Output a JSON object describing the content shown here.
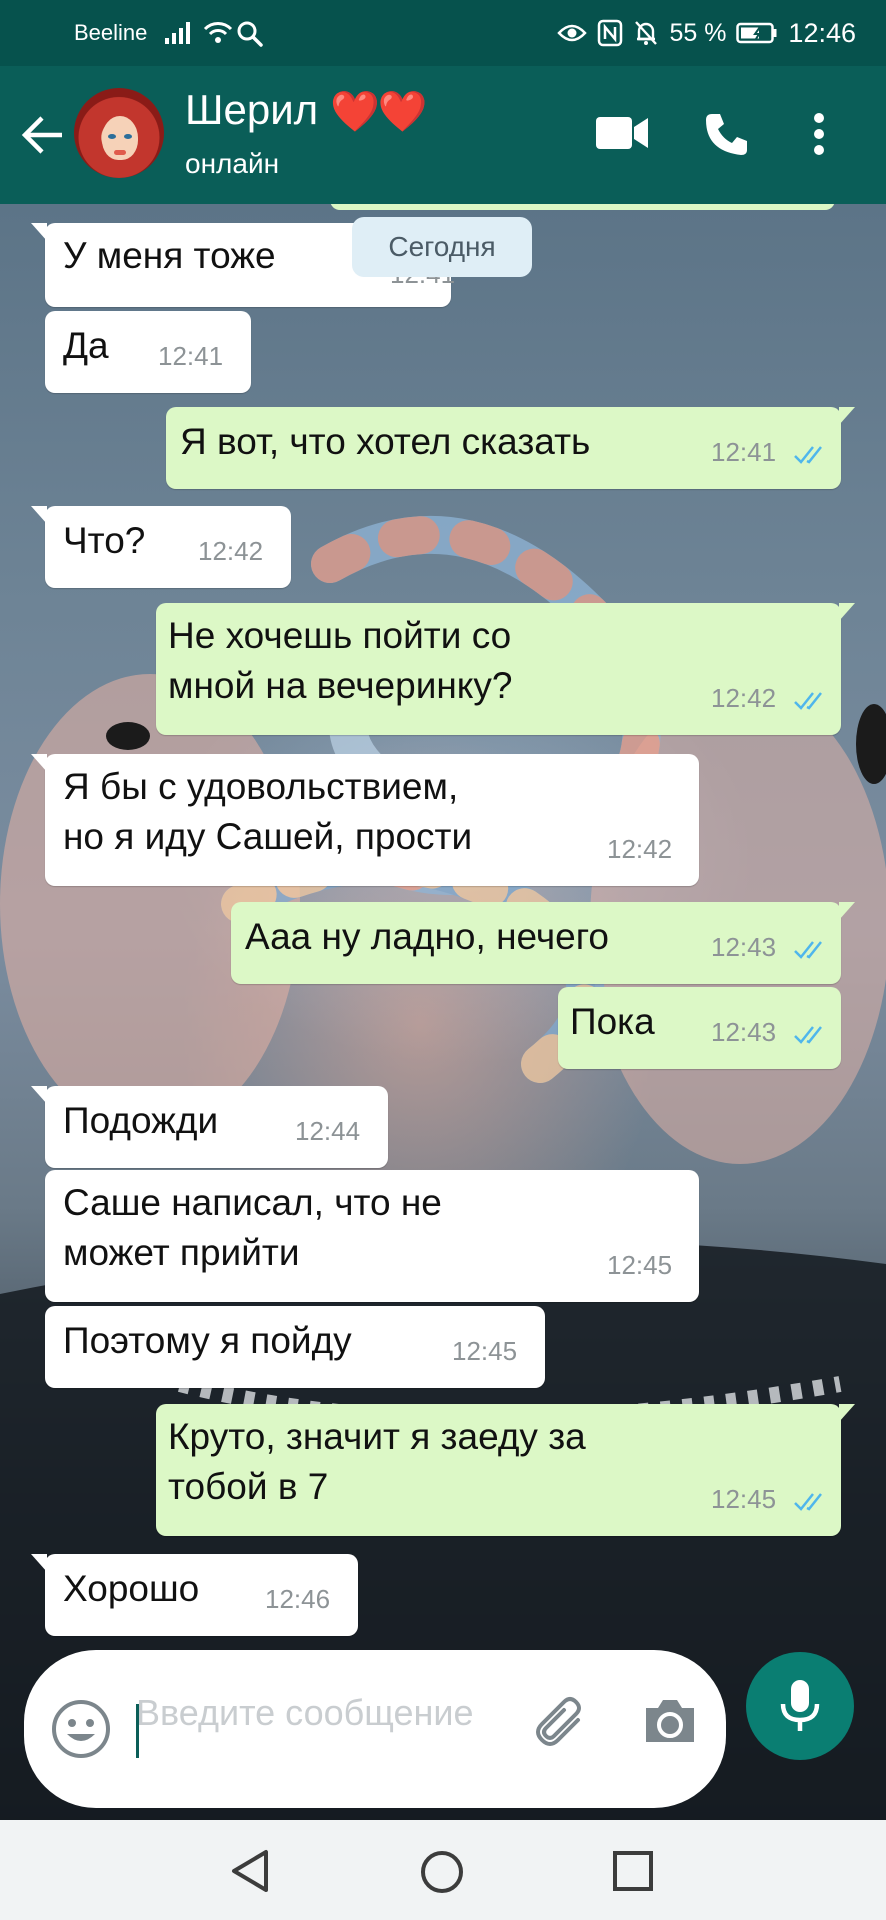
{
  "status_bar": {
    "carrier": "Beeline",
    "battery_percent": "55 %",
    "time": "12:46"
  },
  "header": {
    "contact_name": "Шерил",
    "contact_hearts": "❤️❤️",
    "contact_status": "онлайн"
  },
  "chat": {
    "date_label": "Сегодня",
    "messages": [
      {
        "direction": "in",
        "text": "У меня тоже",
        "time": "12:41"
      },
      {
        "direction": "in",
        "text": "Да",
        "time": "12:41"
      },
      {
        "direction": "out",
        "text": "Я вот, что хотел сказать",
        "time": "12:41",
        "status": "read"
      },
      {
        "direction": "in",
        "text": "Что?",
        "time": "12:42"
      },
      {
        "direction": "out",
        "text": " Не хочешь пойти со\nмной на вечеринку?",
        "time": "12:42",
        "status": "read"
      },
      {
        "direction": "in",
        "text": "Я бы с удовольствием,\nно я иду Сашей, прости",
        "time": "12:42"
      },
      {
        "direction": "out",
        "text": "Ааа ну ладно, нечего",
        "time": "12:43",
        "status": "read"
      },
      {
        "direction": "out",
        "text": "Пока",
        "time": "12:43",
        "status": "read"
      },
      {
        "direction": "in",
        "text": "Подожди",
        "time": "12:44"
      },
      {
        "direction": "in",
        "text": "Саше написал, что не\nможет прийти",
        "time": "12:45"
      },
      {
        "direction": "in",
        "text": "Поэтому я пойду",
        "time": "12:45"
      },
      {
        "direction": "out",
        "text": "Круто, значит я заеду за\nтобой в 7",
        "time": "12:45",
        "status": "read"
      },
      {
        "direction": "in",
        "text": "Хорошо",
        "time": "12:46"
      }
    ]
  },
  "composer": {
    "placeholder": "Введите сообщение"
  },
  "colors": {
    "header": "#0a5e58",
    "status_bar": "#06524d",
    "outgoing_bubble": "#dcf8c6",
    "incoming_bubble": "#ffffff",
    "read_ticks": "#4fb6ec",
    "mic_button": "#0a7e72"
  },
  "icons": {
    "back": "arrow-left-icon",
    "video": "video-camera-icon",
    "call": "phone-icon",
    "menu": "more-vertical-icon",
    "emoji": "emoji-icon",
    "attach": "paperclip-icon",
    "camera": "camera-icon",
    "mic": "microphone-icon"
  }
}
